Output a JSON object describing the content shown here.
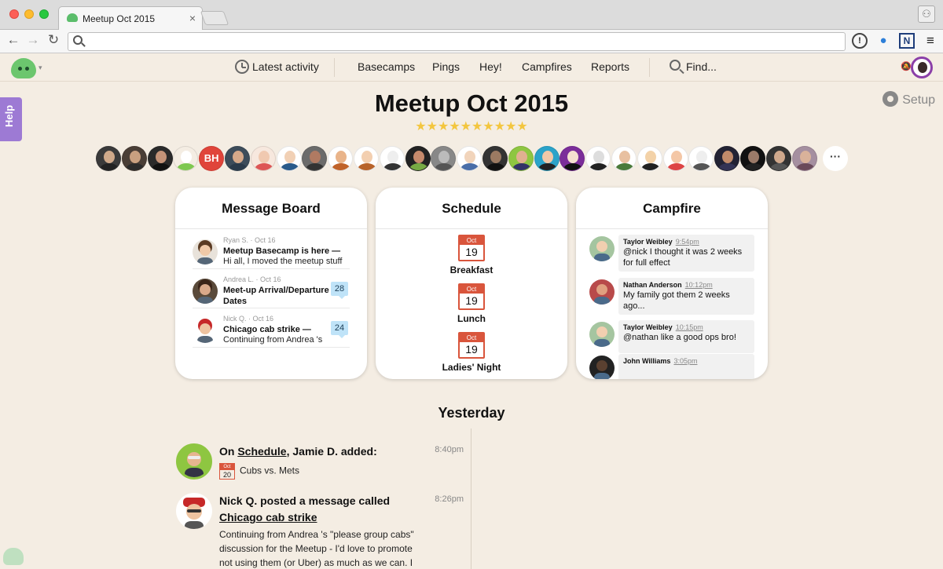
{
  "browser": {
    "tab_title": "Meetup Oct 2015",
    "tab_close": "×",
    "nav_back": "←",
    "nav_forward": "→",
    "nav_reload": "↻",
    "url": "",
    "ext_info": "!",
    "ext_ghost": "●",
    "ext_n": "N",
    "menu": "≡",
    "profile": "⚇"
  },
  "appnav": {
    "latest_activity": "Latest activity",
    "basecamps": "Basecamps",
    "pings": "Pings",
    "hey": "Hey!",
    "campfires": "Campfires",
    "reports": "Reports",
    "find": "Find...",
    "caret": "▾",
    "bell": "🔕"
  },
  "help": "Help",
  "setup": "Setup",
  "project": {
    "title": "Meetup Oct 2015",
    "stars": "★★★★★★★★★★",
    "people_more": "···",
    "people": [
      {
        "skin": "#cfa98a",
        "bg": "#3a3a3a",
        "shirt": "#222"
      },
      {
        "skin": "#c9a080",
        "bg": "#4a3e36",
        "shirt": "#2b2b2b"
      },
      {
        "skin": "#c49378",
        "bg": "#2a2a2a",
        "shirt": "#111"
      },
      {
        "skin": "#ffffff",
        "bg": "#f4ede3",
        "shirt": "#7ec850"
      },
      {
        "initials": "BH"
      },
      {
        "skin": "#d6a98a",
        "bg": "#3d4c5a",
        "shirt": "#2b3a4a"
      },
      {
        "skin": "#f0c9b0",
        "bg": "#f7e8de",
        "shirt": "#d55"
      },
      {
        "skin": "#f1d0b5",
        "bg": "#fff",
        "shirt": "#2a5a8a"
      },
      {
        "skin": "#b07a62",
        "bg": "#6b6b6b",
        "shirt": "#333"
      },
      {
        "skin": "#e9b48a",
        "bg": "#fff",
        "shirt": "#c0632a"
      },
      {
        "skin": "#f3cfb0",
        "bg": "#fff",
        "shirt": "#b8632a"
      },
      {
        "skin": "#eee",
        "bg": "#fff",
        "shirt": "#333"
      },
      {
        "skin": "#c68a6c",
        "bg": "#222",
        "shirt": "#7a4"
      },
      {
        "skin": "#bbb",
        "bg": "#888",
        "shirt": "#555"
      },
      {
        "skin": "#f1d4bb",
        "bg": "#fff",
        "shirt": "#4a6ea8"
      },
      {
        "skin": "#9b7a62",
        "bg": "#333",
        "shirt": "#111"
      },
      {
        "skin": "#e0b090",
        "bg": "#8ec641",
        "shirt": "#336"
      },
      {
        "skin": "#f0c8a8",
        "bg": "#2aa3c9",
        "shirt": "#222"
      },
      {
        "skin": "#f5e0d0",
        "bg": "#7b2d9a",
        "shirt": "#111"
      },
      {
        "skin": "#ddd",
        "bg": "#fff",
        "shirt": "#222"
      },
      {
        "skin": "#e8c0a0",
        "bg": "#fff",
        "shirt": "#4a7a3a"
      },
      {
        "skin": "#f3d2a8",
        "bg": "#fff",
        "shirt": "#222"
      },
      {
        "skin": "#f4c7a6",
        "bg": "#fff",
        "shirt": "#d44"
      },
      {
        "skin": "#eee",
        "bg": "#fff",
        "shirt": "#555"
      },
      {
        "skin": "#c08a6a",
        "bg": "#223",
        "shirt": "#335"
      },
      {
        "skin": "#9a7a68",
        "bg": "#111",
        "shirt": "#222"
      },
      {
        "skin": "#cfa88c",
        "bg": "#333",
        "shirt": "#555"
      },
      {
        "skin": "#d9b29a",
        "bg": "#a58fa0",
        "shirt": "#6a4a5a"
      }
    ]
  },
  "message_board": {
    "title": "Message Board",
    "messages": [
      {
        "meta": "Ryan S. · Oct 16",
        "title": "Meetup Basecamp is here —",
        "excerpt": "Hi all, I moved the meetup stuff",
        "comments": "",
        "skin": "#f0c9a8",
        "hair": "#5a3a22",
        "bg": "#e8e2da"
      },
      {
        "meta": "Andrea L. · Oct 16",
        "title": "Meet-up Arrival/Departure Dates",
        "excerpt": "",
        "comments": "28",
        "skin": "#d9a98a",
        "hair": "#3a2418",
        "bg": "#5a4a3a"
      },
      {
        "meta": "Nick Q. · Oct 16",
        "title": "Chicago cab strike —",
        "excerpt": "Continuing from Andrea 's",
        "comments": "24",
        "skin": "#eec3a0",
        "hair": "#c62828",
        "bg": "#fff"
      }
    ]
  },
  "schedule": {
    "title": "Schedule",
    "events": [
      {
        "month": "Oct",
        "day": "19",
        "label": "Breakfast"
      },
      {
        "month": "Oct",
        "day": "19",
        "label": "Lunch"
      },
      {
        "month": "Oct",
        "day": "19",
        "label": "Ladies' Night"
      }
    ]
  },
  "campfire": {
    "title": "Campfire",
    "lines": [
      {
        "name": "Taylor Weibley",
        "time": "9:54pm",
        "text": "@nick I thought it was 2 weeks for full effect",
        "skin": "#f1cfb0",
        "bg": "#a5c5a0"
      },
      {
        "name": "Nathan Anderson",
        "time": "10:12pm",
        "text": "My family got them 2 weeks ago...",
        "skin": "#e0a080",
        "bg": "#b84a4a"
      },
      {
        "name": "Taylor Weibley",
        "time": "10:15pm",
        "text": "@nathan like a good ops bro!",
        "skin": "#f1cfb0",
        "bg": "#a5c5a0"
      },
      {
        "name": "John Williams",
        "time": "3:05pm",
        "text": "",
        "skin": "#5a4030",
        "bg": "#222"
      }
    ]
  },
  "activity": {
    "heading": "Yesterday",
    "events": [
      {
        "prefix": "On ",
        "link": "Schedule",
        "suffix": ", Jamie D. added:",
        "time": "8:40pm",
        "cal_month": "Oct",
        "cal_day": "20",
        "detail": "Cubs vs. Mets"
      },
      {
        "head": "Nick Q. posted a message called",
        "link": "Chicago cab strike",
        "time": "8:26pm",
        "body_lines": [
          "Continuing from Andrea 's \"please group cabs\"",
          "discussion for the Meetup - I'd love to promote",
          "not using them (or Uber) as much as we can. I"
        ]
      }
    ]
  }
}
